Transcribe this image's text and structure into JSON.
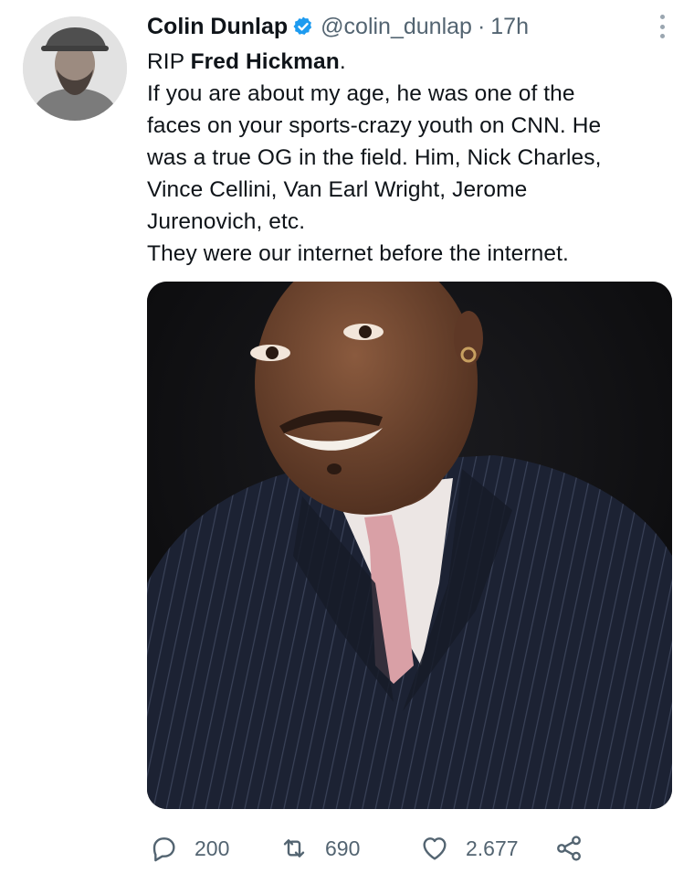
{
  "tweet": {
    "author": {
      "name": "Colin Dunlap",
      "handle": "@colin_dunlap",
      "verified": true
    },
    "time_separator": "·",
    "time": "17h",
    "text": {
      "line1_prefix": "RIP ",
      "line1_bold": "Fred Hickman",
      "line1_suffix": ".",
      "lines": [
        "If you are about my age, he was one of the",
        "faces on your sports-crazy youth on CNN. He",
        "was a true OG in the field. Him, Nick Charles,",
        "Vince Cellini, Van Earl Wright, Jerome",
        "Jurenovich, etc.",
        "They were our internet before the internet."
      ]
    },
    "actions": {
      "replies": "200",
      "retweets": "690",
      "likes": "2.677"
    }
  },
  "icons": {
    "verified": "verified-badge-icon",
    "more": "more-vertical-icon",
    "reply": "reply-icon",
    "retweet": "retweet-icon",
    "like": "heart-icon",
    "share": "share-icon"
  },
  "colors": {
    "verified_blue": "#1d9bf0",
    "secondary_text": "#536471",
    "primary_text": "#0f1419"
  }
}
